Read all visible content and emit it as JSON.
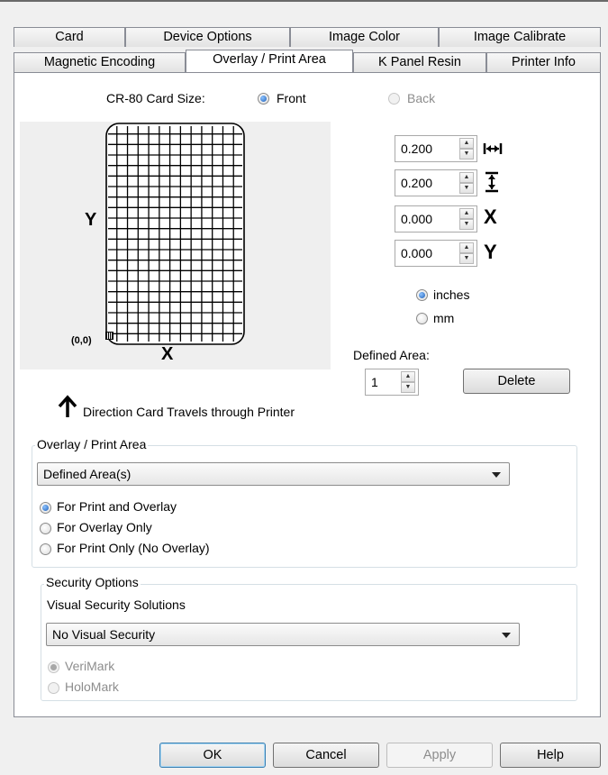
{
  "tabs_row1": [
    "Card",
    "Device Options",
    "Image Color",
    "Image Calibrate"
  ],
  "tabs_row2": [
    "Magnetic Encoding",
    "Overlay / Print Area",
    "K Panel Resin",
    "Printer Info"
  ],
  "active_tab": "Overlay / Print Area",
  "card_size": {
    "label": "CR-80 Card Size:",
    "front": "Front",
    "back": "Back",
    "selected": "Front"
  },
  "diagram": {
    "y_label": "Y",
    "x_label": "X",
    "origin_label": "(0,0)"
  },
  "spinners": [
    {
      "value": "0.200",
      "icon": "width-arrows-icon"
    },
    {
      "value": "0.200",
      "icon": "height-arrows-icon"
    },
    {
      "value": "0.000",
      "icon": "x-offset-icon",
      "label": "X"
    },
    {
      "value": "0.000",
      "icon": "y-offset-icon",
      "label": "Y"
    }
  ],
  "units": {
    "inches": "inches",
    "mm": "mm",
    "selected": "inches"
  },
  "defined_area": {
    "label": "Defined Area:",
    "value": "1",
    "delete_label": "Delete"
  },
  "direction_text": "Direction Card Travels through Printer",
  "overlay_group": {
    "legend": "Overlay / Print Area",
    "combo_value": "Defined Area(s)",
    "options": [
      "For Print and Overlay",
      "For Overlay Only",
      "For Print Only (No Overlay)"
    ],
    "selected": "For Print and Overlay"
  },
  "security_group": {
    "legend": "Security Options",
    "sublabel": "Visual Security Solutions",
    "combo_value": "No Visual Security",
    "options": [
      "VeriMark",
      "HoloMark"
    ],
    "selected": "VeriMark"
  },
  "footer_buttons": {
    "ok": "OK",
    "cancel": "Cancel",
    "apply": "Apply",
    "help": "Help"
  },
  "colors": {
    "accent": "#1f5fb8",
    "panel_border": "#898c95",
    "group_border": "#d5dfe5"
  }
}
